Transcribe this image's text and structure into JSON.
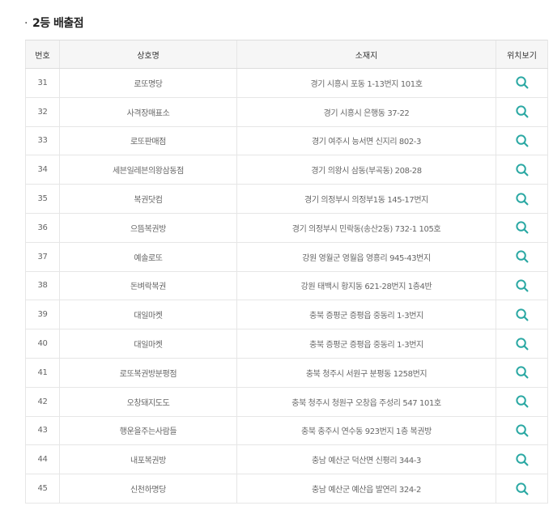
{
  "section": {
    "bullet": "·",
    "title": "2등 배출점"
  },
  "table": {
    "headers": {
      "no": "번호",
      "name": "상호명",
      "address": "소재지",
      "map": "위치보기"
    },
    "rows": [
      {
        "no": "31",
        "name": "로또명당",
        "address": "경기 시흥시 포동 1-13번지 101호"
      },
      {
        "no": "32",
        "name": "사격장매표소",
        "address": "경기 시흥시 은행동 37-22"
      },
      {
        "no": "33",
        "name": "로또판매점",
        "address": "경기 여주시 능서면 신지리 802-3"
      },
      {
        "no": "34",
        "name": "세븐일레븐의왕삼동점",
        "address": "경기 의왕시 삼동(부곡동) 208-28"
      },
      {
        "no": "35",
        "name": "복권닷컴",
        "address": "경기 의정부시 의정부1동 145-17번지"
      },
      {
        "no": "36",
        "name": "으뜸복권방",
        "address": "경기 의정부시 민락동(송산2동) 732-1 105호"
      },
      {
        "no": "37",
        "name": "예솔로또",
        "address": "강원 영월군 영월읍 영흥리 945-43번지"
      },
      {
        "no": "38",
        "name": "돈벼락복권",
        "address": "강원 태백시 황지동 621-28번지 1층4반"
      },
      {
        "no": "39",
        "name": "대일마켓",
        "address": "충북 증평군 증평읍 중동리 1-3번지"
      },
      {
        "no": "40",
        "name": "대일마켓",
        "address": "충북 증평군 증평읍 중동리 1-3번지"
      },
      {
        "no": "41",
        "name": "로또복권방분평점",
        "address": "충북 청주시 서원구 분평동 1258번지"
      },
      {
        "no": "42",
        "name": "오창돼지도도",
        "address": "충북 청주시 청원구 오창읍 주성리 547 101호"
      },
      {
        "no": "43",
        "name": "행운을주는사람들",
        "address": "충북 충주시 연수동 923번지 1층 복권방"
      },
      {
        "no": "44",
        "name": "내포복권방",
        "address": "충남 예산군 덕산면 신평리 344-3"
      },
      {
        "no": "45",
        "name": "신천하명당",
        "address": "충남 예산군 예산읍 발연리 324-2"
      }
    ]
  },
  "colors": {
    "search_icon": "#2aa8a3"
  },
  "icons": {
    "map": "search-icon"
  }
}
